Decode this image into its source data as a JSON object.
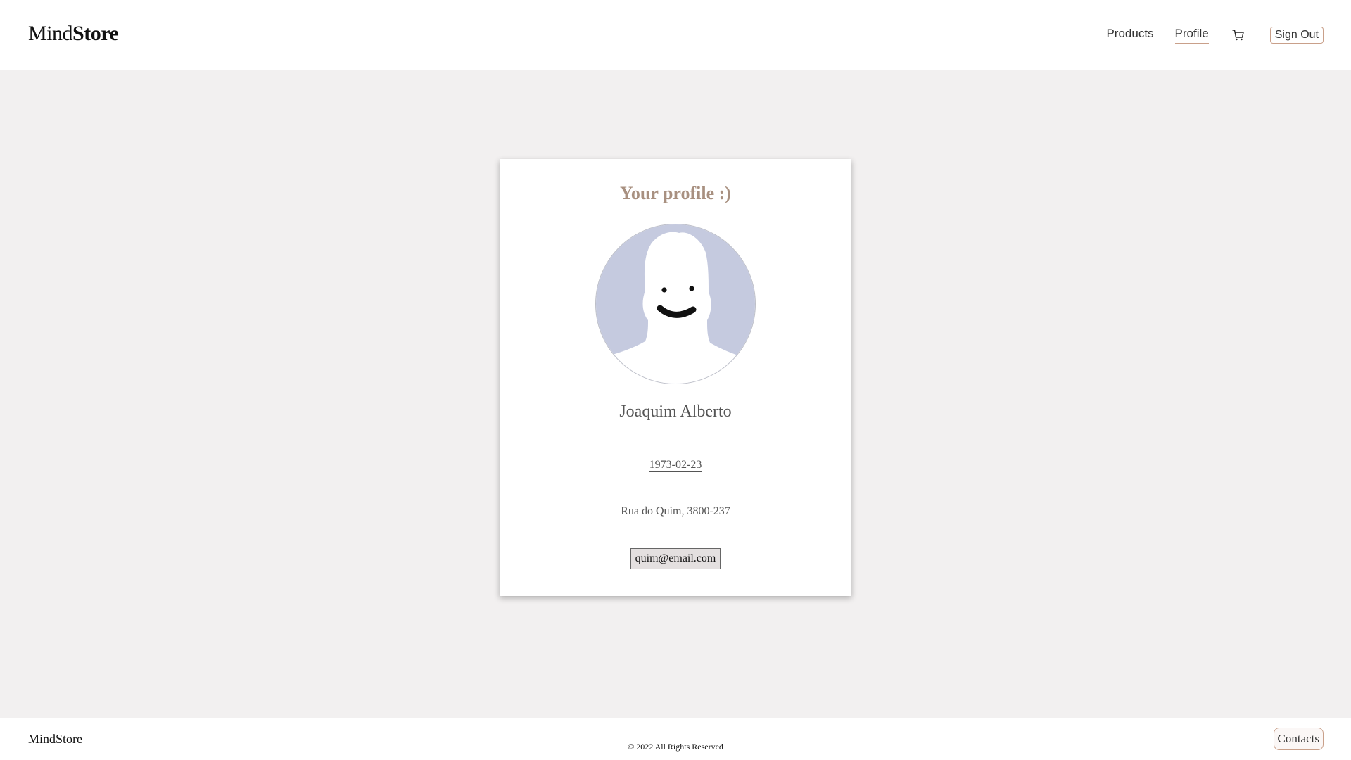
{
  "header": {
    "brand_part1": "Mind",
    "brand_part2": "Store",
    "nav": {
      "products_label": "Products",
      "profile_label": "Profile",
      "cart_icon": "cart-icon",
      "signout_label": "Sign Out"
    }
  },
  "profile": {
    "title": "Your profile :)",
    "avatar_icon": "avatar-icon",
    "name": "Joaquim Alberto",
    "birthdate": "1973-02-23",
    "address": "Rua do Quim, 3800-237",
    "email": "quim@email.com"
  },
  "footer": {
    "brand": "MindStore",
    "copyright": "© 2022 All Rights Reserved",
    "contacts_label": "Contacts"
  },
  "colors": {
    "background": "#f2f0f0",
    "accent": "#c9a08a",
    "title": "#a89080",
    "avatar_bg": "#c5cadf"
  }
}
